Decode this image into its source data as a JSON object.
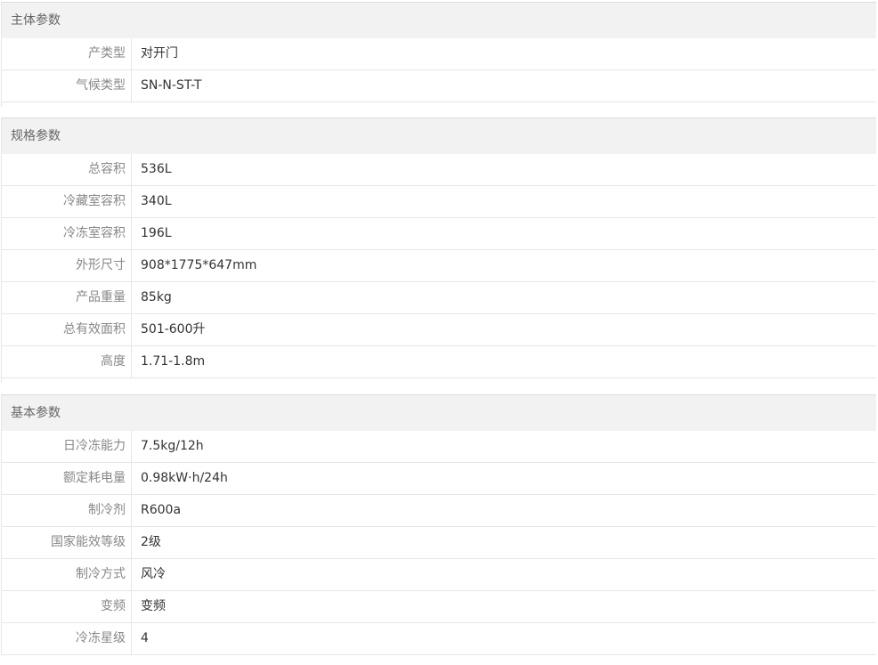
{
  "sections": [
    {
      "title": "主体参数",
      "rows": [
        {
          "label": "产类型",
          "value": "对开门"
        },
        {
          "label": "气候类型",
          "value": "SN-N-ST-T"
        }
      ]
    },
    {
      "title": "规格参数",
      "rows": [
        {
          "label": "总容积",
          "value": "536L"
        },
        {
          "label": "冷藏室容积",
          "value": "340L"
        },
        {
          "label": "冷冻室容积",
          "value": "196L"
        },
        {
          "label": "外形尺寸",
          "value": "908*1775*647mm"
        },
        {
          "label": "产品重量",
          "value": "85kg"
        },
        {
          "label": "总有效面积",
          "value": "501-600升"
        },
        {
          "label": "高度",
          "value": "1.71-1.8m"
        }
      ]
    },
    {
      "title": "基本参数",
      "rows": [
        {
          "label": "日冷冻能力",
          "value": "7.5kg/12h"
        },
        {
          "label": "额定耗电量",
          "value": "0.98kW·h/24h"
        },
        {
          "label": "制冷剂",
          "value": "R600a"
        },
        {
          "label": "国家能效等级",
          "value": "2级"
        },
        {
          "label": "制冷方式",
          "value": "风冷"
        },
        {
          "label": "变频",
          "value": "变频"
        },
        {
          "label": "冷冻星级",
          "value": "4"
        }
      ]
    }
  ]
}
